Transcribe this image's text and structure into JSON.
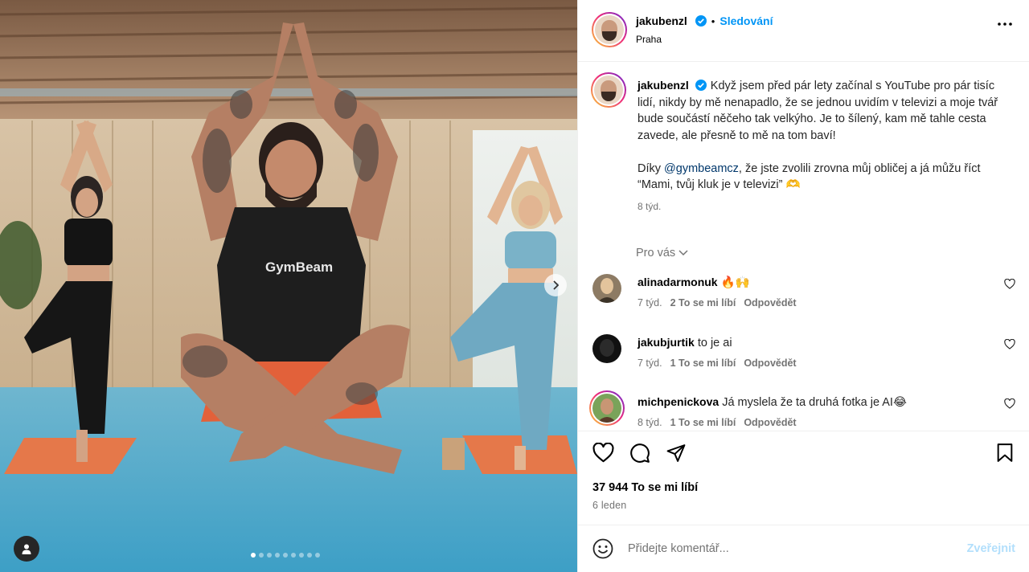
{
  "header": {
    "username": "jakubenzl",
    "separator": "•",
    "follow_label": "Sledování",
    "location": "Praha"
  },
  "caption": {
    "username": "jakubenzl",
    "text_part1": "Když jsem před pár lety začínal s YouTube pro pár tisíc lidí, nikdy by mě nenapadlo, že se jednou uvidím v televizi a moje tvář bude součástí něčeho tak velkýho. Je to šílený, kam mě tahle cesta zavede, ale přesně to mě na tom baví!",
    "text_part2_before": "Díky ",
    "mention": "@gymbeamcz",
    "text_part2_after": ", že jste zvolili zrovna můj obličej a já můžu říct “Mami, tvůj kluk je v televizi” 🫶",
    "time": "8 týd."
  },
  "for_you_label": "Pro vás",
  "comments": [
    {
      "username": "alinadarmonuk",
      "text": "🔥🙌",
      "time": "7 týd.",
      "likes": "2 To se mi líbí",
      "reply": "Odpovědět"
    },
    {
      "username": "jakubjurtik",
      "text": "to je ai",
      "time": "7 týd.",
      "likes": "1 To se mi líbí",
      "reply": "Odpovědět"
    },
    {
      "username": "michpenickova",
      "text": "Já myslela že ta druhá fotka je AI😂",
      "time": "8 týd.",
      "likes": "1 To se mi líbí",
      "reply": "Odpovědět"
    }
  ],
  "post_stats": {
    "likes": "37 944 To se mi líbí",
    "date": "6 leden"
  },
  "add_comment": {
    "placeholder": "Přidejte komentář...",
    "post_label": "Zveřejnit"
  },
  "media": {
    "brand_text": "GymBeam",
    "carousel_count": 9,
    "carousel_active": 0
  },
  "icons": {
    "verified": "verified-badge-icon",
    "more": "more-options-icon",
    "like": "heart-icon",
    "comment": "comment-icon",
    "share": "share-icon",
    "save": "bookmark-icon",
    "emoji": "emoji-icon",
    "next": "chevron-right-icon",
    "tag": "user-tag-icon"
  },
  "colors": {
    "accent": "#0095f6",
    "mention": "#00376b",
    "muted": "#737373"
  }
}
